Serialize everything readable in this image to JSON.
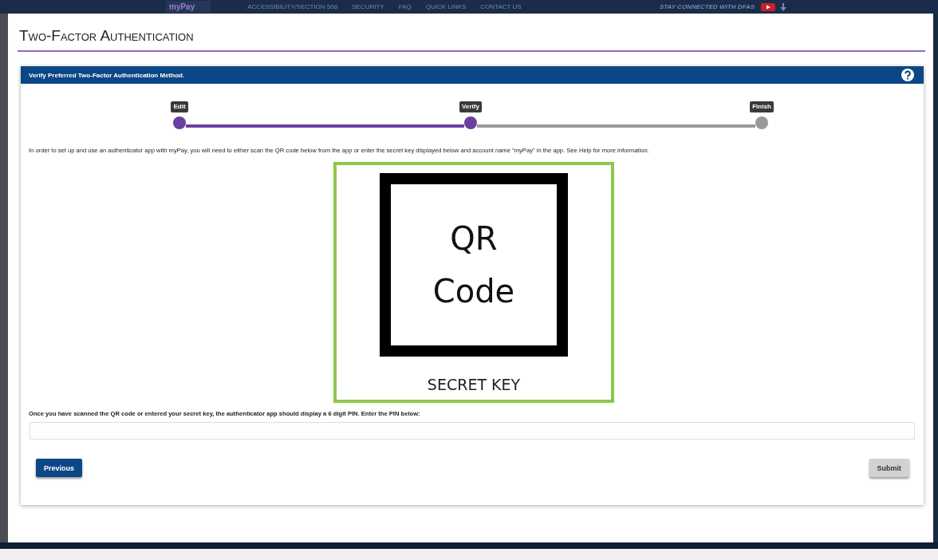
{
  "top_nav": {
    "logo": "myPay",
    "links": [
      "ACCESSIBILITY/SECTION 508",
      "SECURITY",
      "FAQ",
      "QUICK LINKS",
      "CONTACT US"
    ],
    "social_label": "STAY CONNECTED WITH DFAS"
  },
  "dialog": {
    "title": "Two-Factor Authentication",
    "panel": {
      "header": "Verify Preferred Two-Factor Authentication Method.",
      "progress": {
        "steps": [
          {
            "label": "Edit",
            "reached": true
          },
          {
            "label": "Verify",
            "reached": true
          },
          {
            "label": "Finish",
            "reached": false
          }
        ]
      },
      "instructions": "In order to set up and use an authenticator app with myPay, you will need to either scan the QR code below from the app or enter the secret key displayed below and account name \"myPay\" in the app. See Help for more information.",
      "qr_placeholder": {
        "lines": [
          "QR",
          "Code"
        ]
      },
      "secret_key": "SECRET KEY",
      "pin_prompt": "Once you have scanned the QR code or entered your secret key, the authenticator app should display a 6 digit PIN. Enter the PIN below:",
      "buttons": [
        {
          "label": "Previous",
          "kind": "primary"
        },
        {
          "label": "Submit",
          "kind": "secondary"
        }
      ]
    }
  }
}
